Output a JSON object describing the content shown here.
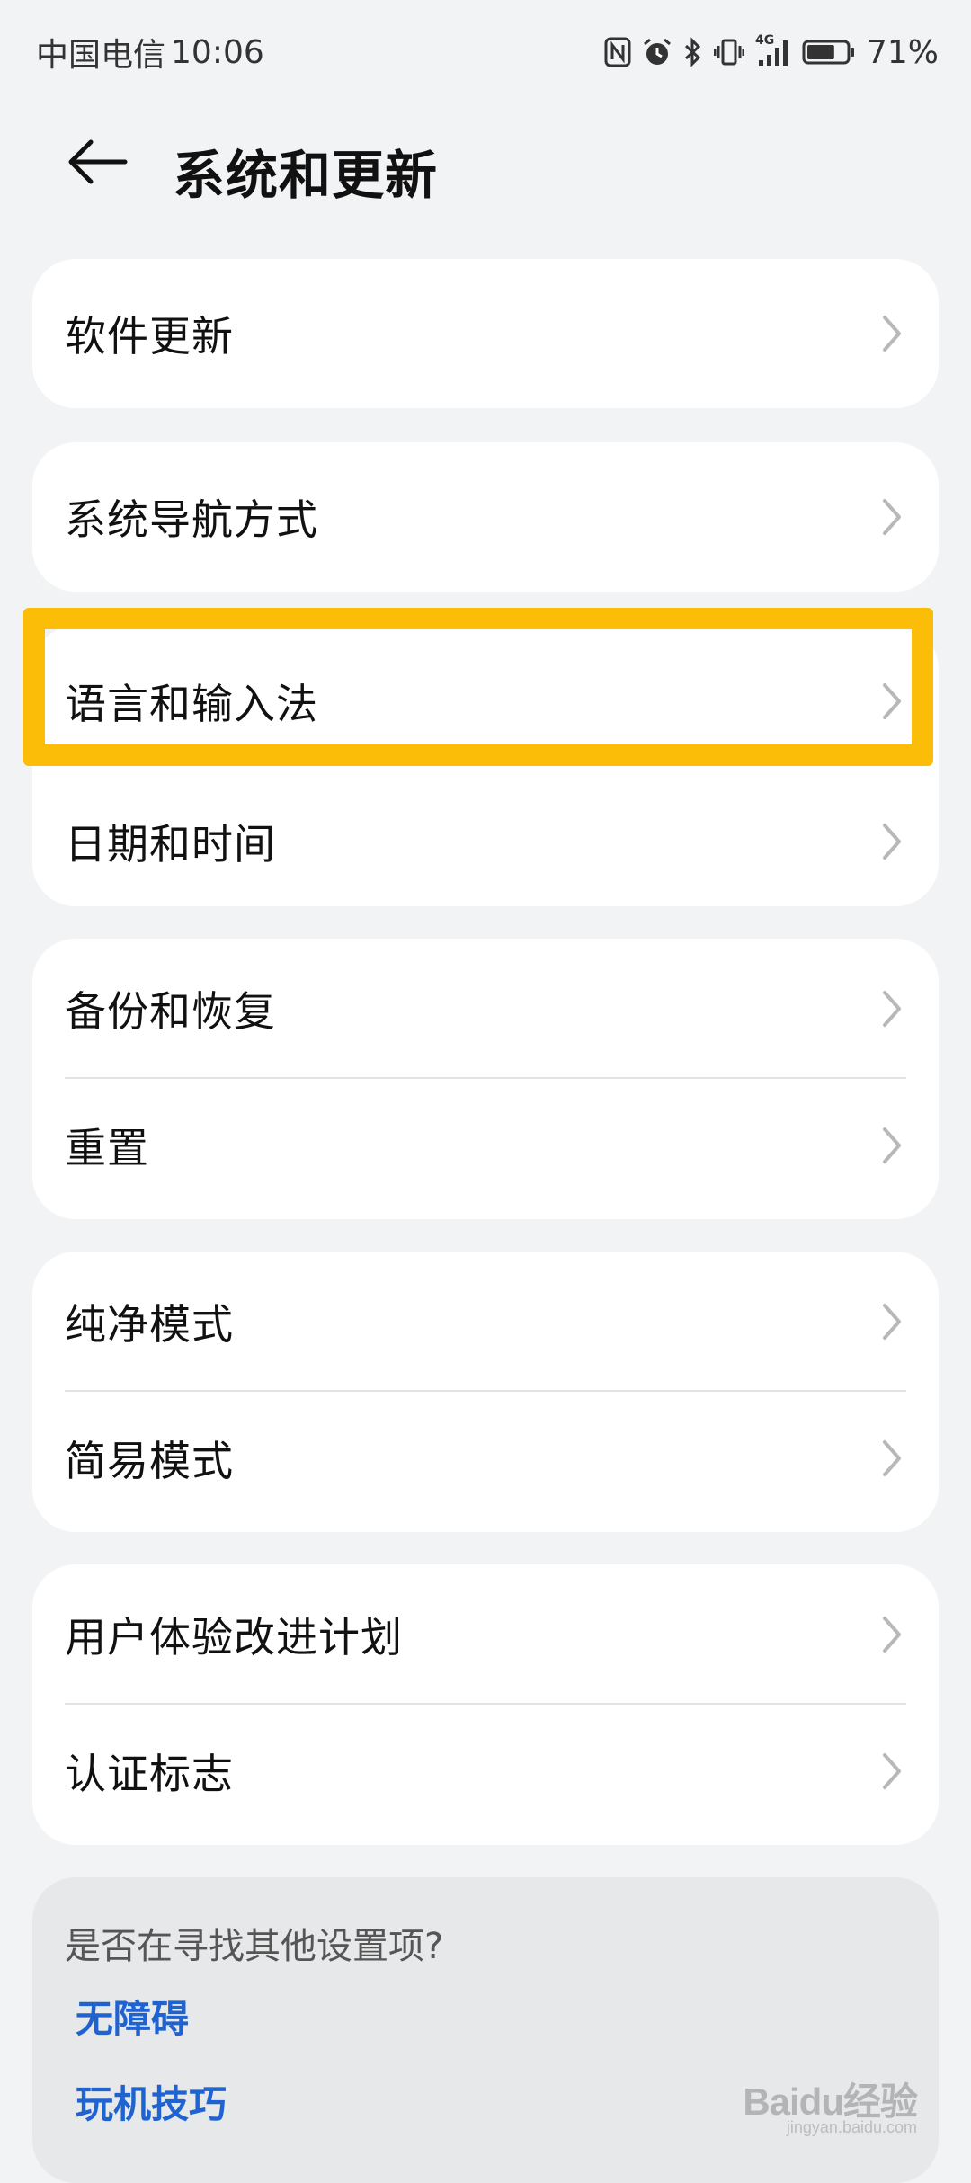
{
  "status_bar": {
    "carrier": "中国电信",
    "time": "10:06",
    "network": "4G",
    "battery": "71%",
    "battery_level": 0.71
  },
  "header": {
    "title": "系统和更新",
    "back_icon": "back-arrow-icon"
  },
  "groups": [
    {
      "items": [
        {
          "label": "软件更新"
        }
      ]
    },
    {
      "items": [
        {
          "label": "系统导航方式"
        }
      ]
    },
    {
      "items": [
        {
          "label": "语言和输入法"
        },
        {
          "label": "日期和时间"
        }
      ]
    },
    {
      "items": [
        {
          "label": "备份和恢复"
        },
        {
          "label": "重置"
        }
      ]
    },
    {
      "items": [
        {
          "label": "纯净模式"
        },
        {
          "label": "简易模式"
        }
      ]
    },
    {
      "items": [
        {
          "label": "用户体验改进计划"
        },
        {
          "label": "认证标志"
        }
      ]
    }
  ],
  "suggestions": {
    "title": "是否在寻找其他设置项?",
    "links": [
      "无障碍",
      "玩机技巧"
    ]
  },
  "watermark": {
    "main": "Baidu经验",
    "sub": "jingyan.baidu.com"
  },
  "colors": {
    "background": "#f1f3f5",
    "card": "#ffffff",
    "highlight": "#fbbd08",
    "link": "#1f63d1"
  }
}
